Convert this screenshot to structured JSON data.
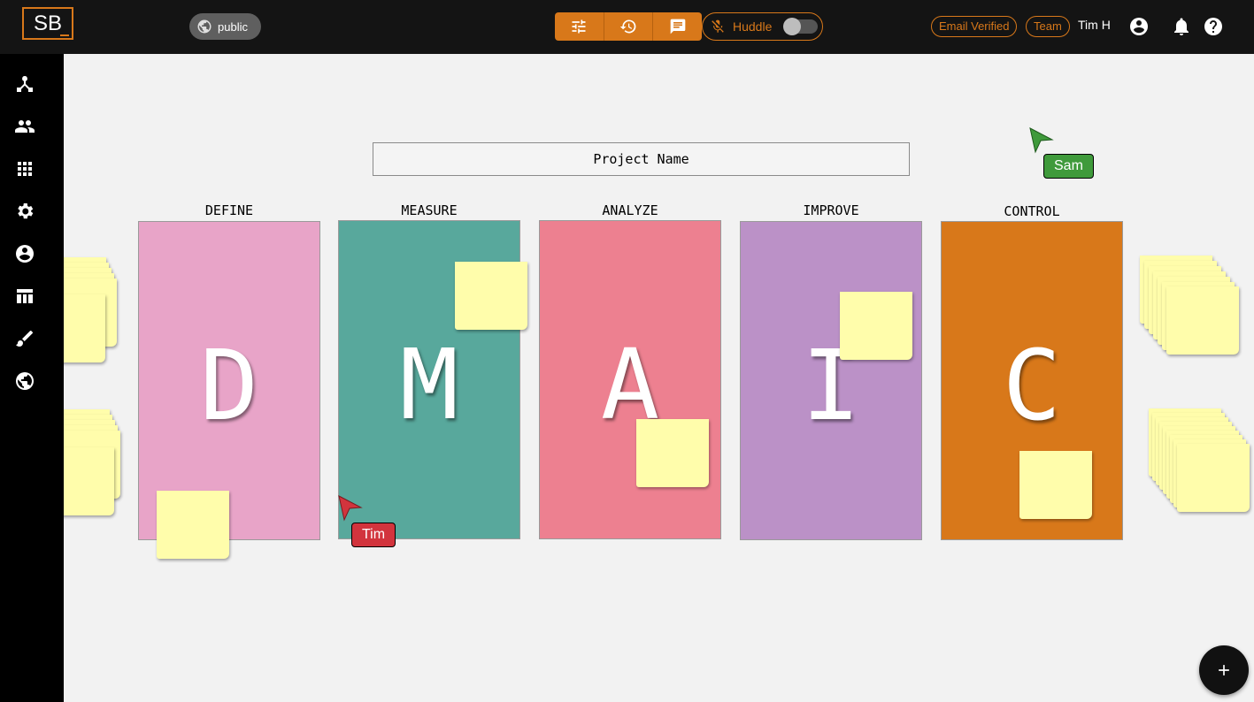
{
  "app": {
    "logo": "SB"
  },
  "header": {
    "visibility": "public",
    "huddle_label": "Huddle",
    "badges": [
      "Email Verified",
      "Team"
    ],
    "user_name": "Tim H"
  },
  "board": {
    "project_name": "Project Name",
    "columns": [
      {
        "title": "DEFINE",
        "letter": "D",
        "color": "#e8a4c8"
      },
      {
        "title": "MEASURE",
        "letter": "M",
        "color": "#58a89c"
      },
      {
        "title": "ANALYZE",
        "letter": "A",
        "color": "#ed8090"
      },
      {
        "title": "IMPROVE",
        "letter": "I",
        "color": "#bb91c7"
      },
      {
        "title": "CONTROL",
        "letter": "C",
        "color": "#d8781a"
      }
    ],
    "sticky_color": "#fffdab"
  },
  "cursors": [
    {
      "name": "Sam",
      "color": "#3f9a3b"
    },
    {
      "name": "Tim",
      "color": "#d2343d"
    }
  ],
  "icons": {
    "sidebar": [
      "network-icon",
      "people-icon",
      "grid-icon",
      "gear-icon",
      "account-icon",
      "table-icon",
      "brush-icon",
      "globe-icon"
    ],
    "toolbar": [
      "sliders-icon",
      "history-icon",
      "chat-icon"
    ],
    "huddle": "mic-off-icon",
    "top_right": [
      "account-circle-icon",
      "bell-icon",
      "help-icon"
    ],
    "fab": "plus-icon"
  },
  "colors": {
    "accent": "#d8781a",
    "topbar": "#141414",
    "canvas": "#f2f2f2"
  }
}
